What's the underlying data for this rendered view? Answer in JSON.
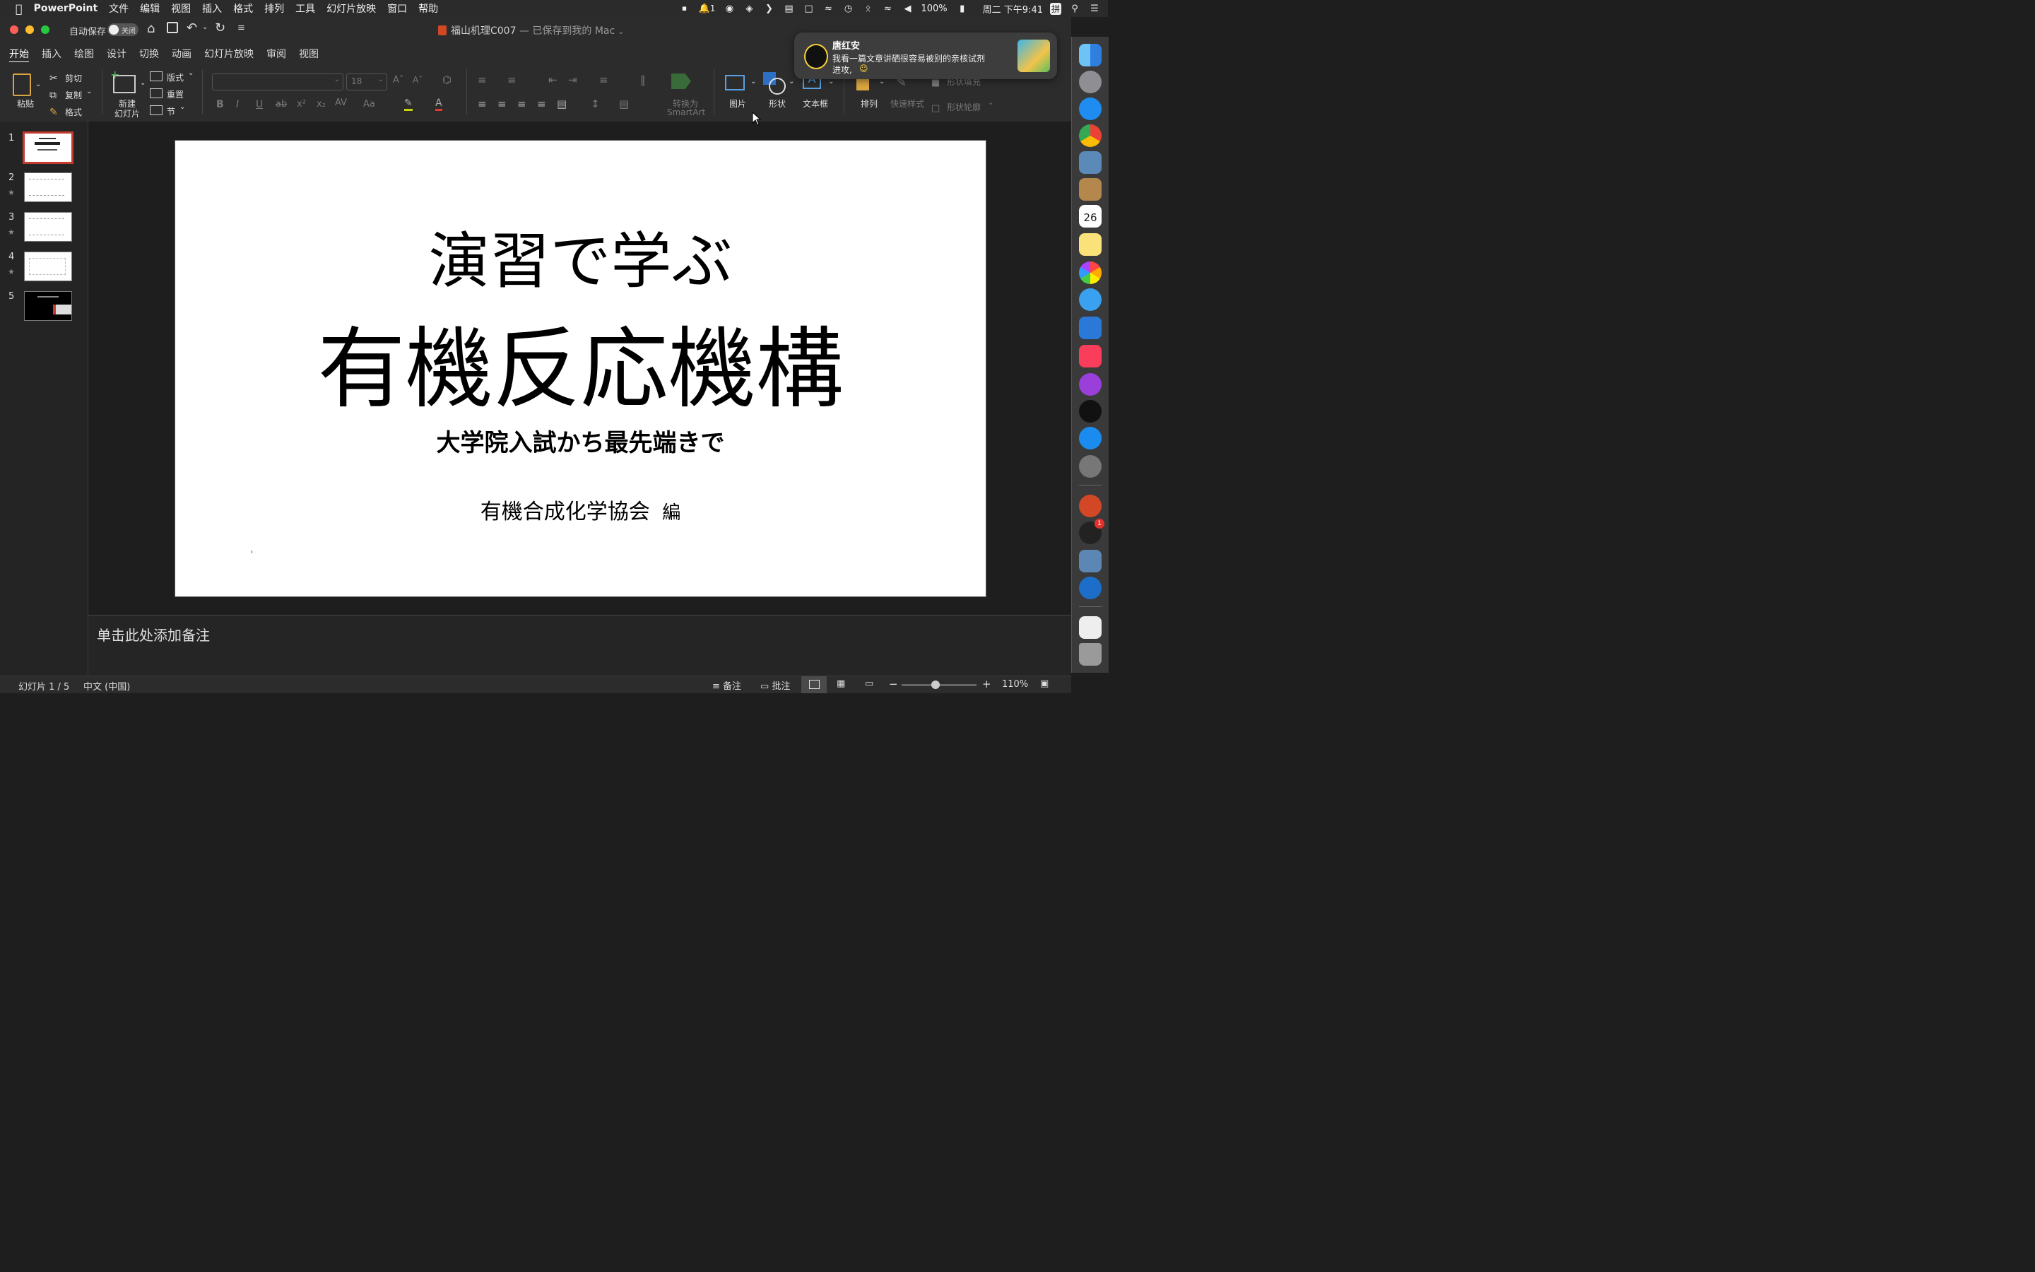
{
  "menubar": {
    "app_name": "PowerPoint",
    "items": [
      "文件",
      "编辑",
      "视图",
      "插入",
      "格式",
      "排列",
      "工具",
      "幻灯片放映",
      "窗口",
      "帮助"
    ],
    "notification_count": "1",
    "battery": "100%",
    "clock": "周二 下午9:41",
    "input_method": "拼"
  },
  "titlebar": {
    "autosave_label": "自动保存",
    "autosave_state": "关闭",
    "doc_title": "福山机理C007",
    "save_status": "— 已保存到我的 Mac"
  },
  "ribbon_tabs": [
    "开始",
    "插入",
    "绘图",
    "设计",
    "切换",
    "动画",
    "幻灯片放映",
    "审阅",
    "视图"
  ],
  "ribbon": {
    "paste": "粘贴",
    "cut": "剪切",
    "copy": "复制",
    "format": "格式",
    "new_slide_1": "新建",
    "new_slide_2": "幻灯片",
    "layout": "版式",
    "reset": "重置",
    "section": "节",
    "font_size": "18",
    "convert_smartart_1": "转换为",
    "convert_smartart_2": "SmartArt",
    "picture": "图片",
    "shape": "形状",
    "textbox": "文本框",
    "arrange": "排列",
    "quick_styles": "快速样式",
    "shape_fill": "形状填充",
    "shape_outline": "形状轮廓"
  },
  "slides": {
    "numbers": [
      "1",
      "2",
      "3",
      "4",
      "5"
    ]
  },
  "slide": {
    "line1": "演習で学ぶ",
    "line2": "有機反応機構",
    "line3": "大学院入試かち最先端きで",
    "line4": "有機合成化学協会",
    "line4_suffix": "編"
  },
  "notes": {
    "placeholder": "单击此处添加备注"
  },
  "statusbar": {
    "slide_indicator": "幻灯片 1 / 5",
    "language": "中文 (中国)",
    "notes": "备注",
    "comments": "批注",
    "zoom": "110%",
    "zoom_level": 0.45
  },
  "notification": {
    "sender": "唐红安",
    "message_line1": "我看一篇文章讲硒很容易被别的亲核试剂",
    "message_line2": "进攻,"
  },
  "dock": {
    "calendar_day": "26",
    "qq_badge": "1"
  },
  "colors": {
    "accent_red": "#c43b2f",
    "ppt_orange": "#d24726",
    "ribbon_bg": "#2c2c2c"
  }
}
